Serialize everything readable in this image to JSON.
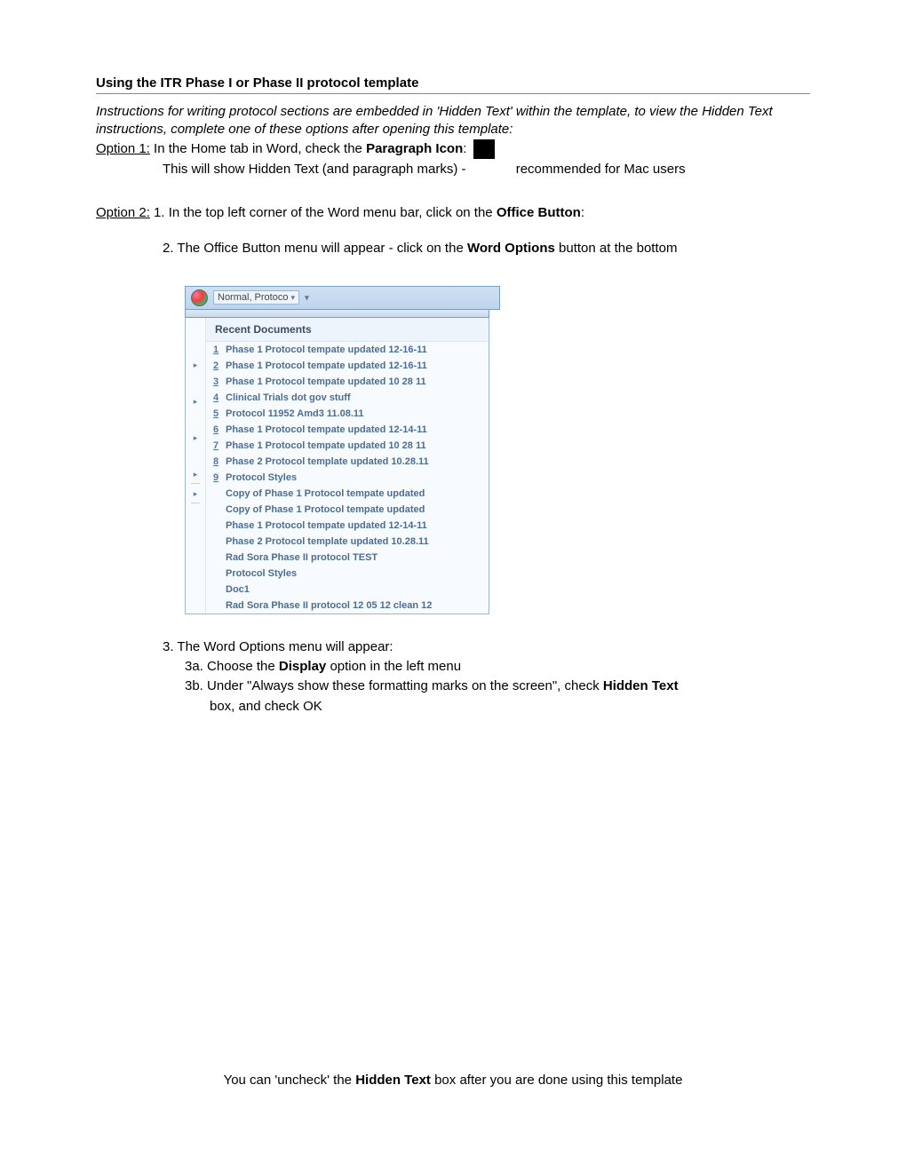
{
  "title": "Using the ITR Phase I or Phase II protocol template",
  "instructions": "Instructions for writing protocol sections are embedded in 'Hidden Text' within the template, to view the Hidden Text instructions, complete one of these options after opening this template:",
  "option1": {
    "label": "Option 1:",
    "line1_a": "  In the Home tab in Word, check the ",
    "line1_b": "Paragraph Icon",
    "line1_c": ":",
    "line2_a": "This will show Hidden Text (and paragraph marks) -",
    "line2_b": "recommended for Mac users"
  },
  "option2": {
    "label": "Option 2:",
    "step1_a": "  1. In the top left corner of the Word menu bar, click on the ",
    "step1_b": "Office Button",
    "step1_c": ":",
    "step2_a": "2. The Office Button menu will appear - click on the ",
    "step2_b": "Word Options",
    "step2_c": " button at the bottom",
    "step3": "3. The Word Options menu will appear:",
    "step3a_a": "3a. Choose the ",
    "step3a_b": "Display",
    "step3a_c": " option in the left menu",
    "step3b_a": "3b. Under \"Always show these formatting marks on the screen\", check ",
    "step3b_b": "Hidden Text",
    "step3b_indent": "box, and check OK"
  },
  "word_menu": {
    "qat_text": "Normal, Protoco",
    "recent_header": "Recent Documents",
    "items": [
      {
        "n": "1",
        "t": "Phase 1 Protocol tempate updated 12-16-11"
      },
      {
        "n": "2",
        "t": "Phase 1 Protocol tempate updated 12-16-11"
      },
      {
        "n": "3",
        "t": "Phase 1 Protocol tempate updated 10 28 11"
      },
      {
        "n": "4",
        "t": "Clinical Trials dot gov stuff"
      },
      {
        "n": "5",
        "t": "Protocol 11952 Amd3 11.08.11"
      },
      {
        "n": "6",
        "t": "Phase 1 Protocol tempate updated 12-14-11"
      },
      {
        "n": "7",
        "t": "Phase 1 Protocol tempate updated 10 28 11"
      },
      {
        "n": "8",
        "t": "Phase 2 Protocol template updated 10.28.11"
      },
      {
        "n": "9",
        "t": "Protocol Styles"
      },
      {
        "n": "",
        "t": "Copy of Phase 1 Protocol tempate updated"
      },
      {
        "n": "",
        "t": "Copy of Phase 1 Protocol tempate updated"
      },
      {
        "n": "",
        "t": "Phase 1 Protocol tempate updated 12-14-11"
      },
      {
        "n": "",
        "t": "Phase 2 Protocol template updated 10.28.11"
      },
      {
        "n": "",
        "t": "Rad Sora Phase II protocol TEST"
      },
      {
        "n": "",
        "t": "Protocol Styles"
      },
      {
        "n": "",
        "t": "Doc1"
      },
      {
        "n": "",
        "t": "Rad Sora Phase II protocol 12 05 12 clean 12"
      }
    ]
  },
  "footer_a": "You can 'uncheck' the ",
  "footer_b": "Hidden Text",
  "footer_c": "  box after you are done using this template"
}
